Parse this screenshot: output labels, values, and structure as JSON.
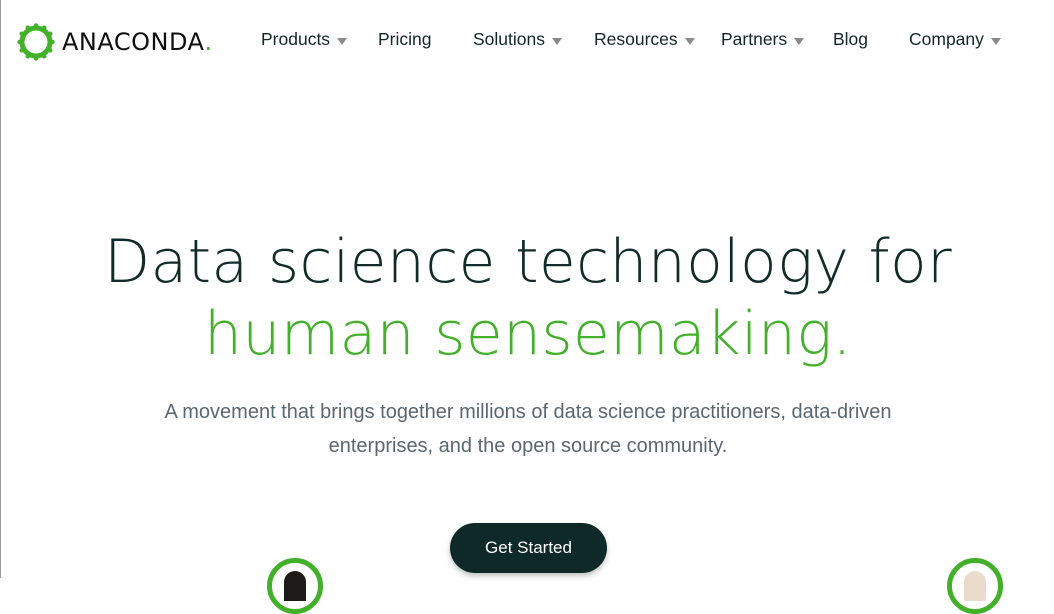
{
  "brand": {
    "name": "ANACONDA",
    "dot": ".",
    "accent_color": "#43b02a",
    "dark_color": "#0f2929",
    "logo_icon": "anaconda-ring-logo"
  },
  "nav": {
    "items": [
      {
        "label": "Products",
        "dropdown": true
      },
      {
        "label": "Pricing",
        "dropdown": false
      },
      {
        "label": "Solutions",
        "dropdown": true
      },
      {
        "label": "Resources",
        "dropdown": true
      },
      {
        "label": "Partners",
        "dropdown": true
      },
      {
        "label": "Blog",
        "dropdown": false
      },
      {
        "label": "Company",
        "dropdown": true
      }
    ]
  },
  "hero": {
    "title_line1": "Data science technology for",
    "title_line2": "human sensemaking.",
    "subtitle": "A movement that brings together millions of data science practitioners, data-driven enterprises, and the open source community.",
    "cta_label": "Get Started"
  }
}
